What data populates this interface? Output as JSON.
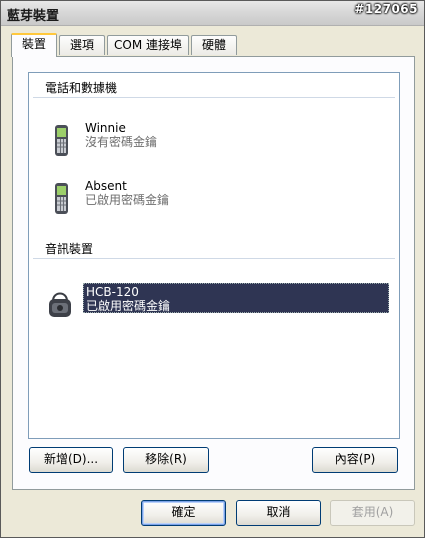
{
  "window": {
    "title": "藍芽裝置",
    "watermark": "#127065",
    "close_glyph": "✕"
  },
  "tabs": [
    {
      "label": "裝置",
      "active": true
    },
    {
      "label": "選項",
      "active": false
    },
    {
      "label": "COM 連接埠",
      "active": false
    },
    {
      "label": "硬體",
      "active": false
    }
  ],
  "groups": {
    "phones": {
      "label": "電話和數據機",
      "devices": [
        {
          "name": "Winnie",
          "status": "沒有密碼金鑰",
          "icon": "mobile-phone-icon"
        },
        {
          "name": "Absent",
          "status": "已啟用密碼金鑰",
          "icon": "mobile-phone-icon"
        }
      ]
    },
    "audio": {
      "label": "音訊裝置",
      "devices": [
        {
          "name": "HCB-120",
          "status": "已啟用密碼金鑰",
          "icon": "headset-icon",
          "selected": true
        }
      ]
    }
  },
  "actions": {
    "add": "新增(D)...",
    "remove": "移除(R)",
    "properties": "內容(P)"
  },
  "dialog": {
    "ok": "確定",
    "cancel": "取消",
    "apply": "套用(A)"
  }
}
